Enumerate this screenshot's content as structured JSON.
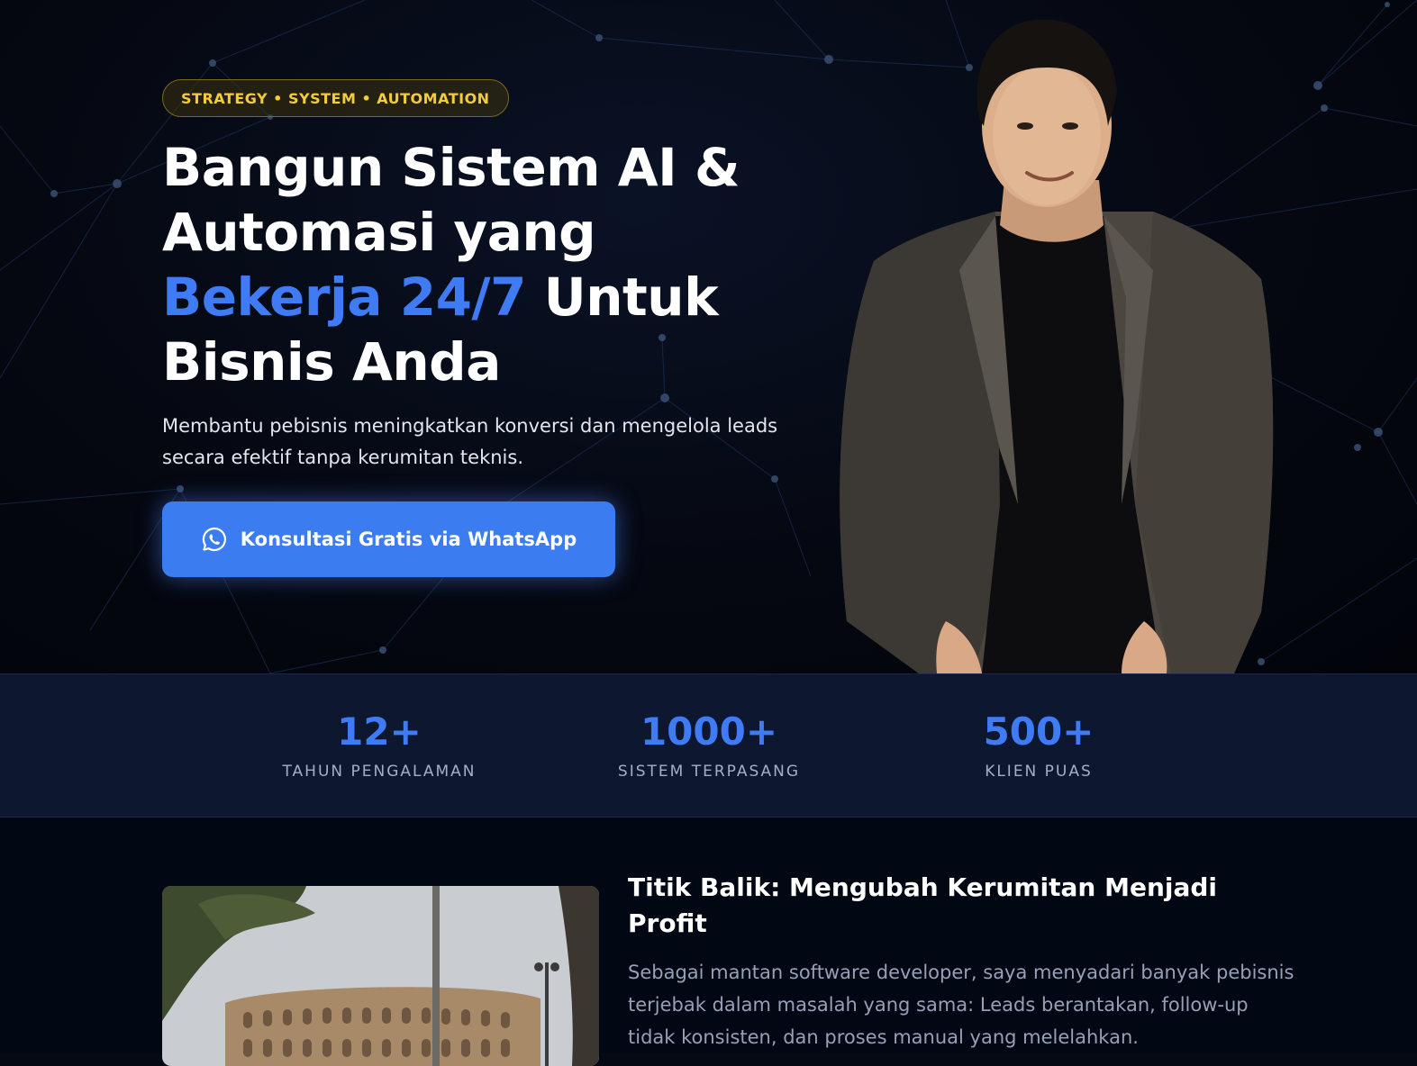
{
  "hero": {
    "badge": "STRATEGY • SYSTEM • AUTOMATION",
    "title_line1": "Bangun Sistem AI &",
    "title_line2": "Automasi yang",
    "title_highlight": "Bekerja 24/7",
    "title_after_highlight": " Untuk",
    "title_line4": "Bisnis Anda",
    "subtitle": "Membantu pebisnis meningkatkan konversi dan mengelola leads secara efektif tanpa kerumitan teknis.",
    "cta_label": "Konsultasi Gratis via WhatsApp",
    "cta_icon": "whatsapp-icon"
  },
  "stats": [
    {
      "value": "12+",
      "label": "TAHUN PENGALAMAN"
    },
    {
      "value": "1000+",
      "label": "SISTEM TERPASANG"
    },
    {
      "value": "500+",
      "label": "KLIEN PUAS"
    }
  ],
  "story": {
    "title": "Titik Balik: Mengubah Kerumitan Menjadi Profit",
    "text": "Sebagai mantan software developer, saya menyadari banyak pebisnis terjebak dalam masalah yang sama: Leads berantakan, follow-up tidak konsisten, dan proses manual yang melelahkan."
  },
  "colors": {
    "accent": "#3f7bf5",
    "badge_text": "#f2cc3a",
    "stats_bg": "#0d1730",
    "hero_bg": "#050811"
  }
}
